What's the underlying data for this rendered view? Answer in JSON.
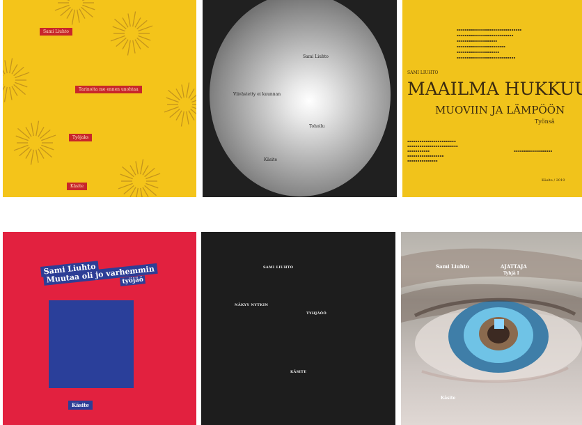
{
  "covers": [
    {
      "labels": [
        "Sami Liuhto",
        "Tarinoita me ennen unohtaa",
        "Työjaks",
        "Käsite"
      ]
    },
    {
      "labels": [
        "Sami Liuhto",
        "Viivästetty ei kuunnan",
        "Tohoilu",
        "Käsite"
      ]
    },
    {
      "author": "SAMI LIUHTO",
      "title_line1": "MAAILMA HUKKUU",
      "title_line2": "MUOVIIN JA LÄMPÖÖN",
      "subtitle": "Työnsä",
      "publisher_mark": "Käsite / 2019"
    },
    {
      "author": "Sami Liuhto",
      "title_line1": "Muutaa oli jo varhemmin",
      "title_line2": "työjäö",
      "publisher": "Käsite"
    },
    {
      "labels": [
        "SAMI LIUHTO",
        "NÄKYY NYTKIN",
        "TYHJÄÖÖ",
        "KÄSITE"
      ]
    },
    {
      "author": "Sami Liuhto",
      "title": "AJATTAJA",
      "subtitle": "Tyhjä I",
      "publisher": "Käsite"
    }
  ]
}
